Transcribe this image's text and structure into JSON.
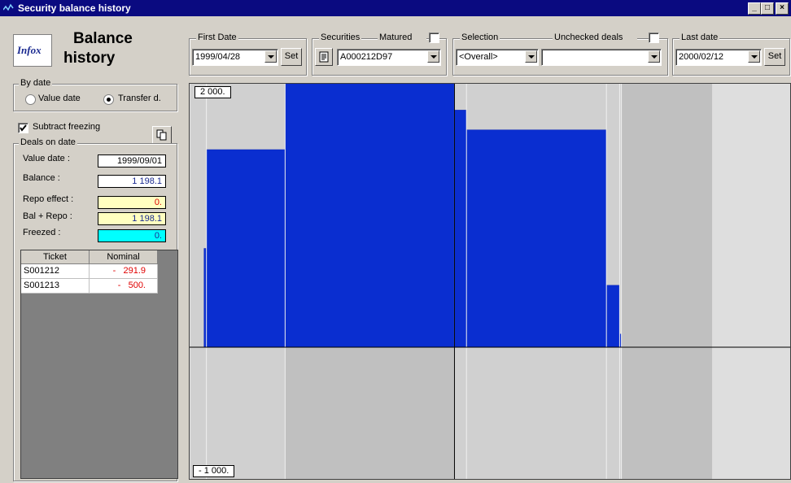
{
  "window": {
    "title": "Security balance history",
    "minimize": "_",
    "maximize": "□",
    "close": "×"
  },
  "app": {
    "logo_text": "Infox",
    "heading_line1": "Balance",
    "heading_line2": "history"
  },
  "toolbar": {
    "first_date": {
      "label": "First Date",
      "value": "1999/04/28",
      "set_label": "Set"
    },
    "securities": {
      "label": "Securities",
      "matured_label": "Matured",
      "value": "A000212D97"
    },
    "selection": {
      "label": "Selection",
      "value": "<Overall>"
    },
    "unchecked": {
      "label": "Unchecked deals",
      "value": ""
    },
    "last_date": {
      "label": "Last date",
      "value": "2000/02/12",
      "set_label": "Set"
    }
  },
  "by_date": {
    "label": "By date",
    "value_date": "Value date",
    "transfer": "Transfer d.",
    "selected": "transfer"
  },
  "subtract_freezing": {
    "label": "Subtract freezing",
    "checked": true
  },
  "deals": {
    "label": "Deals on date",
    "value_date_label": "Value date :",
    "value_date": "1999/09/01",
    "balance_label": "Balance :",
    "balance": "1 198.1",
    "repo_label": "Repo effect :",
    "repo": "0.",
    "bal_repo_label": "Bal + Repo :",
    "bal_repo": "1 198.1",
    "freezed_label": "Freezed :",
    "freezed": "0."
  },
  "table": {
    "columns": [
      "Ticket",
      "Nominal"
    ],
    "rows": [
      {
        "ticket": "S001212",
        "nominal": "-   291.9"
      },
      {
        "ticket": "S001213",
        "nominal": "-   500."
      }
    ]
  },
  "chart_data": {
    "type": "area",
    "ymax_label": "2 000.",
    "ymin_label": "- 1 000.",
    "ylim": [
      -1000,
      2000
    ],
    "colors": {
      "bar": "#0a2ed0",
      "bar_edge": "#0622b8",
      "bg_dark": "#c0c0c0",
      "bg_light": "#d0d0d0",
      "bg_lighter": "#dedede"
    },
    "x": [
      0,
      0.028,
      0.159,
      0.441,
      0.461,
      0.694,
      0.716,
      0.719
    ],
    "steps": [
      {
        "x0": 0.024,
        "x1": 0.028,
        "y": 750
      },
      {
        "x0": 0.028,
        "x1": 0.159,
        "y": 1500
      },
      {
        "x0": 0.159,
        "x1": 0.441,
        "y": 2000
      },
      {
        "x0": 0.441,
        "x1": 0.461,
        "y": 1800
      },
      {
        "x0": 0.461,
        "x1": 0.694,
        "y": 1650
      },
      {
        "x0": 0.694,
        "x1": 0.716,
        "y": 470
      },
      {
        "x0": 0.716,
        "x1": 0.719,
        "y": 100
      }
    ],
    "cursor_x": 0.441
  }
}
